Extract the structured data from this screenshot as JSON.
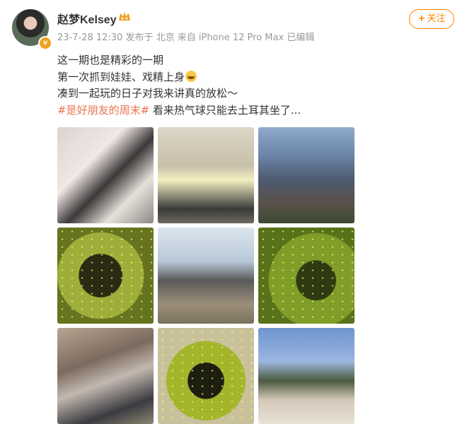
{
  "post": {
    "username": "赵梦Kelsey",
    "meta": "23-7-28 12:30  发布于 北京  来自 iPhone 12 Pro Max  已编辑",
    "follow_label": "关注",
    "follow_icon": "plus-icon",
    "lines": [
      "这一期也是精彩的一期",
      "第一次抓到娃娃、戏精上身",
      "凑到一起玩的日子对我来讲真的放松～"
    ],
    "topic": "#是好朋友的周末#",
    "topic_tail": " 看来热气球只能去土耳其坐了...",
    "avatar_badge": "v",
    "images": [
      {
        "name": "photo-selfie-checkered"
      },
      {
        "name": "photo-sunglasses-yellow-shirt"
      },
      {
        "name": "photo-city-view-evening"
      },
      {
        "name": "photo-green-lights-portrait"
      },
      {
        "name": "photo-group-four-friends"
      },
      {
        "name": "photo-shadow-green-lights"
      },
      {
        "name": "photo-street-walk"
      },
      {
        "name": "photo-green-lights-closeup"
      },
      {
        "name": "photo-sunglasses-duo"
      }
    ]
  },
  "colors": {
    "accent": "#ff8200",
    "topic": "#eb7350",
    "meta_text": "#999999"
  }
}
